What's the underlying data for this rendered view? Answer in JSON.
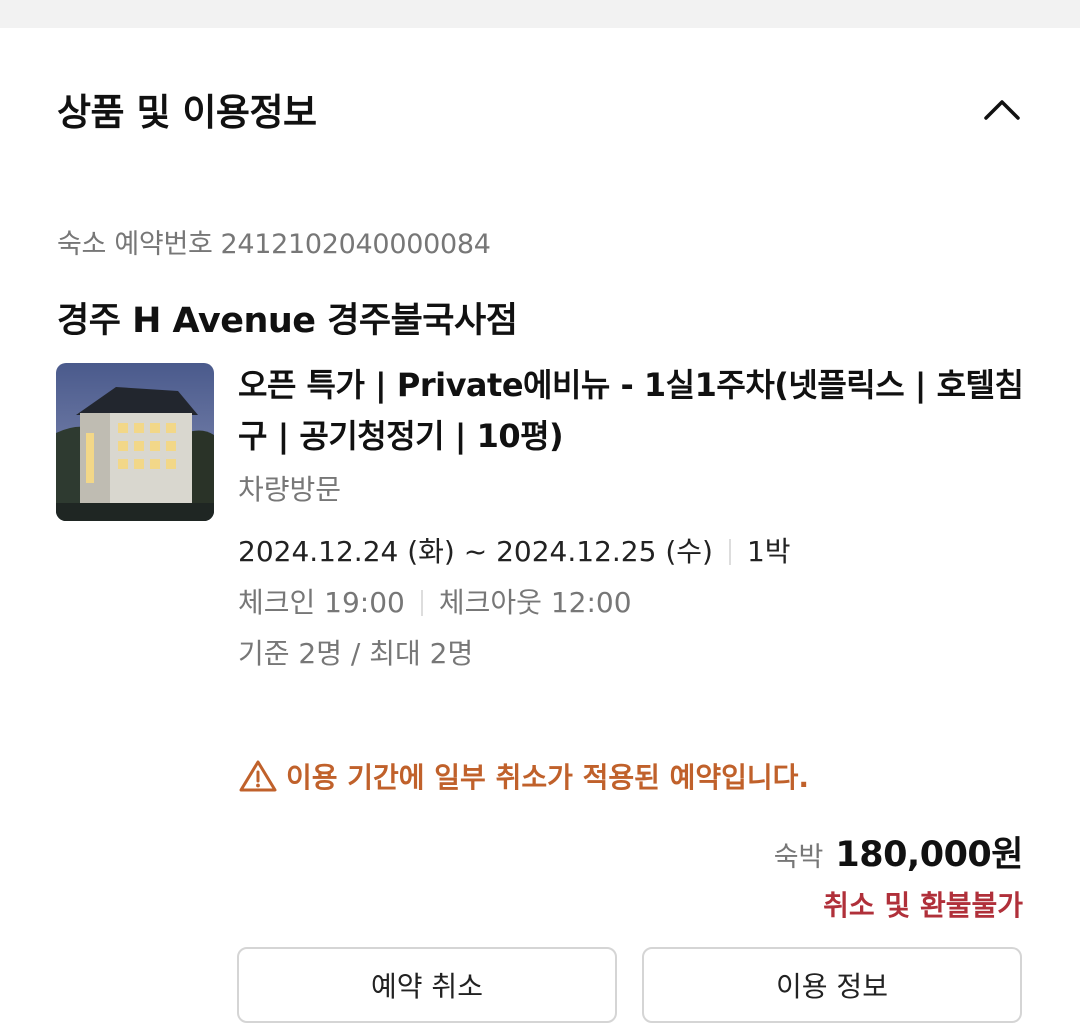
{
  "section": {
    "title": "상품 및 이용정보",
    "toggle_icon": "chevron-up-icon"
  },
  "reservation": {
    "label": "숙소 예약번호",
    "number": "2412102040000084"
  },
  "hotel": {
    "name": "경주 H Avenue 경주불국사점"
  },
  "room": {
    "name": "오픈 특가 | Private에비뉴 - 1실1주차(넷플릭스 | 호텔침구 | 공기청정기 | 10평)",
    "visit_type": "차량방문",
    "thumbnail_icon": "hotel-building-photo"
  },
  "stay": {
    "checkin_date": "2024.12.24 (화)",
    "tilde": "~",
    "checkout_date": "2024.12.25 (수)",
    "nights": "1박",
    "checkin_time": "체크인 19:00",
    "checkout_time": "체크아웃 12:00",
    "capacity": "기준 2명 / 최대 2명"
  },
  "warning": {
    "text": "이용 기간에 일부 취소가 적용된 예약입니다.",
    "icon": "warning-triangle-icon",
    "color": "#c0612b"
  },
  "price": {
    "label": "숙박",
    "value": "180,000원"
  },
  "refund": {
    "text": "취소 및 환불불가",
    "color": "#b0303a"
  },
  "actions": {
    "cancel_label": "예약 취소",
    "info_label": "이용 정보"
  }
}
